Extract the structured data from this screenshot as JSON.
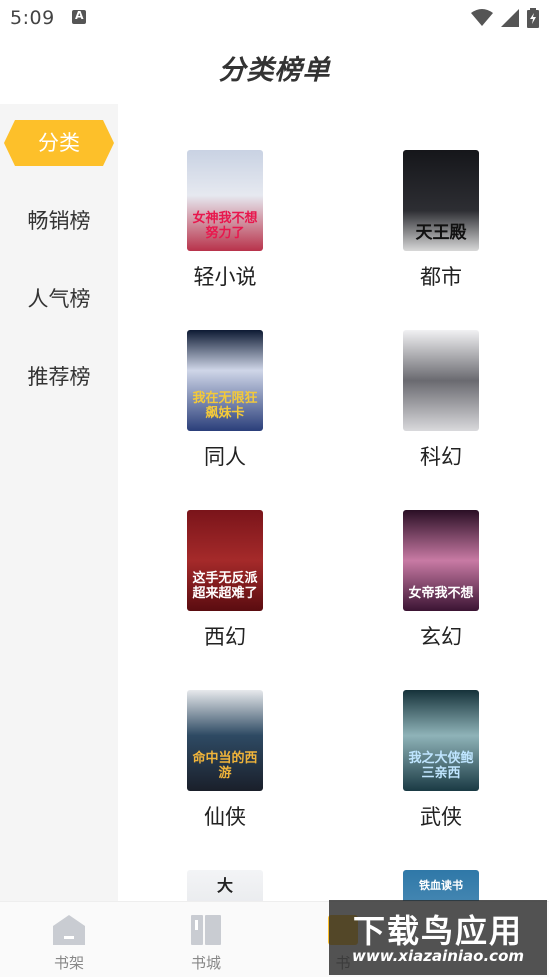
{
  "status_bar": {
    "time": "5:09"
  },
  "title": "分类榜单",
  "sidebar": {
    "items": [
      {
        "label": "分类"
      },
      {
        "label": "畅销榜"
      },
      {
        "label": "人气榜"
      },
      {
        "label": "推荐榜"
      }
    ]
  },
  "categories": [
    {
      "label": "轻小说",
      "cover_text": "女神我不想努力了",
      "cover_color": "#d7dce8"
    },
    {
      "label": "都市",
      "cover_text": "天王殿",
      "cover_color": "#1e1e22"
    },
    {
      "label": "同人",
      "cover_text": "我在无限狂飙妹卡",
      "cover_color": "#1b2a4a"
    },
    {
      "label": "科幻",
      "cover_text": "",
      "cover_color": "#e8e8ea"
    },
    {
      "label": "西幻",
      "cover_text": "这手无反派超来超难了",
      "cover_color": "#8b1a1f"
    },
    {
      "label": "玄幻",
      "cover_text": "女帝我不想",
      "cover_color": "#3a1630"
    },
    {
      "label": "仙侠",
      "cover_text": "命中当的西游",
      "cover_color": "#203040"
    },
    {
      "label": "武侠",
      "cover_text": "我之大侠鲍三亲西",
      "cover_color": "#1d3a40"
    },
    {
      "label": "",
      "cover_text": "大",
      "cover_color": "#eef0f3"
    },
    {
      "label": "",
      "cover_text": "铁血读书",
      "cover_color": "#2c6a92"
    }
  ],
  "tabbar": {
    "items": [
      {
        "label": "书架",
        "icon": "house-icon"
      },
      {
        "label": "书城",
        "icon": "books-icon"
      },
      {
        "label": "书",
        "icon": "tab-icon"
      }
    ]
  },
  "watermark": {
    "top": "下载鸟应用",
    "bottom": "www.xiazainiao.com"
  },
  "colors": {
    "accent": "#fdc02a",
    "sidebar_bg": "#f5f5f5"
  }
}
